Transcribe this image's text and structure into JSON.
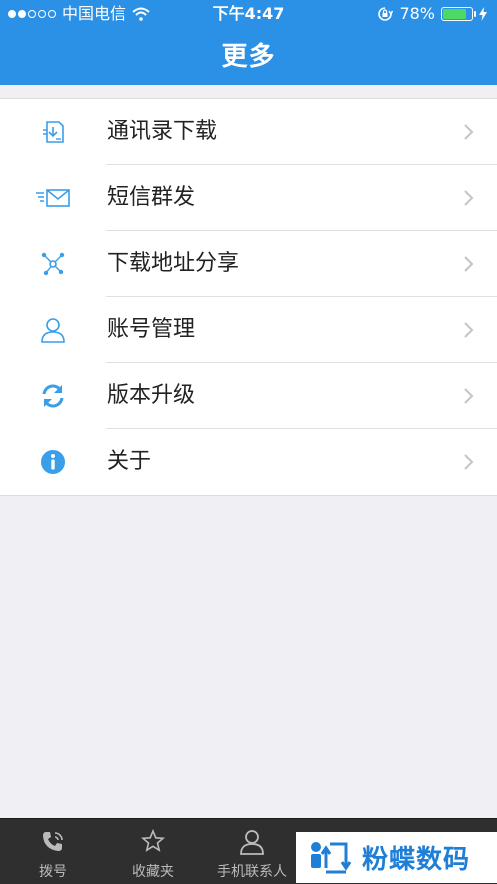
{
  "status_bar": {
    "carrier": "中国电信",
    "time": "下午4:47",
    "battery": "78%",
    "battery_level": 0.78
  },
  "nav": {
    "title": "更多"
  },
  "menu": {
    "items": [
      {
        "label": "通讯录下载",
        "icon": "contacts-download-icon"
      },
      {
        "label": "短信群发",
        "icon": "sms-broadcast-icon"
      },
      {
        "label": "下载地址分享",
        "icon": "share-icon"
      },
      {
        "label": "账号管理",
        "icon": "account-icon"
      },
      {
        "label": "版本升级",
        "icon": "refresh-icon"
      },
      {
        "label": "关于",
        "icon": "info-icon"
      }
    ]
  },
  "tabbar": {
    "items": [
      {
        "label": "拨号",
        "icon": "phone-icon"
      },
      {
        "label": "收藏夹",
        "icon": "star-icon"
      },
      {
        "label": "手机联系人",
        "icon": "person-icon"
      }
    ]
  },
  "watermark": {
    "text": "粉蝶数码"
  },
  "colors": {
    "accent": "#2b91e6",
    "icon": "#3a9ee8",
    "background": "#efeff4"
  }
}
